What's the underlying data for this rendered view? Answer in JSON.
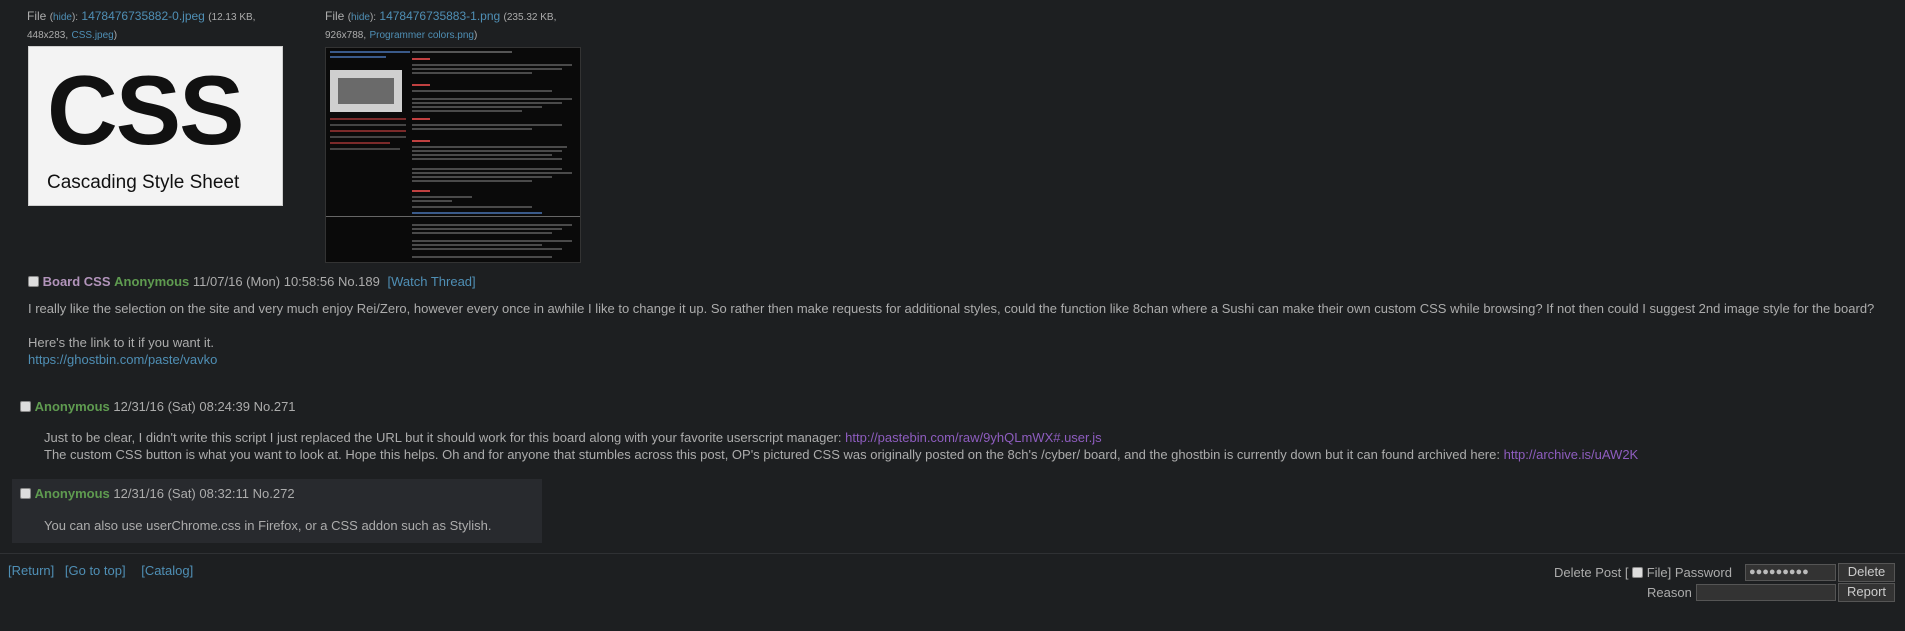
{
  "op": {
    "files": [
      {
        "label": "File",
        "hide_label": "hide",
        "filename": "1478476735882-0.jpeg",
        "size_text": "(12.13 KB,",
        "dims_text": "448x283,",
        "orig_name": "CSS.jpeg",
        "close_paren": ")",
        "thumb_big": "CSS",
        "thumb_sub": "Cascading Style Sheet"
      },
      {
        "label": "File",
        "hide_label": "hide",
        "filename": "1478476735883-1.png",
        "size_text": "(235.32 KB,",
        "dims_text": "926x788,",
        "orig_name": "Programmer colors.png",
        "close_paren": ")"
      }
    ],
    "subject": "Board CSS",
    "name": "Anonymous",
    "date": "11/07/16 (Mon) 10:58:56",
    "no": "No.189",
    "watch": "[Watch Thread]",
    "body_line1": "I really like the selection on the site and very much enjoy Rei/Zero, however every once in awhile I like to change it up.  So rather then make requests for additional styles, could the function like 8chan where a Sushi can make their own custom CSS while browsing?  If not then could I suggest 2nd image style for the board?",
    "body_line2": "Here's the link to it if you want it.",
    "body_link": "https://ghostbin.com/paste/vavko"
  },
  "replies": [
    {
      "name": "Anonymous",
      "date": "12/31/16 (Sat) 08:24:39",
      "no": "No.271",
      "line1_text": "Just to be clear, I didn't write this script I just replaced the URL but it should work for this board along with your favorite userscript manager: ",
      "line1_link": "http://pastebin.com/raw/9yhQLmWX#.user.js",
      "line2_text": "The custom CSS button is what you want to look at. Hope this helps. Oh and for anyone that stumbles across this post, OP's pictured CSS was originally posted on the 8ch's /cyber/ board, and the ghostbin is currently down but it can found archived here: ",
      "line2_link": "http://archive.is/uAW2K"
    },
    {
      "name": "Anonymous",
      "date": "12/31/16 (Sat) 08:32:11",
      "no": "No.272",
      "line1_text": "You can also use userChrome.css in Firefox, or a CSS addon such as Stylish."
    }
  ],
  "footer": {
    "return": "[Return]",
    "top": "[Go to top]",
    "catalog": "[Catalog]",
    "delete_post_label": "Delete Post [",
    "file_label": "File]",
    "password_label": "Password",
    "password_value": "●●●●●●●●●",
    "delete_button": "Delete",
    "reason_label": "Reason",
    "report_button": "Report"
  },
  "colors": {
    "background": "#1d1f21",
    "link": "#4f8fb5",
    "name": "#5f9b50",
    "subject": "#b294bb",
    "visited": "#8e5dbf"
  }
}
